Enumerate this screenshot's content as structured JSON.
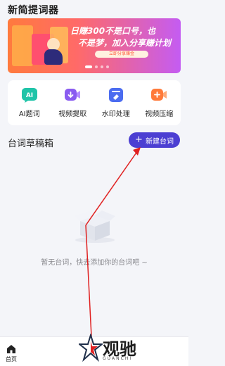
{
  "app": {
    "title": "新简提词器"
  },
  "banner": {
    "line1": "日赚300不是口号，也",
    "line2": "不是梦，加入分享赚计划",
    "cta": "立即分享赚金",
    "slide_count": 4,
    "active_slide": 0
  },
  "tools": [
    {
      "label": "AI题词",
      "icon": "ai-icon",
      "color": "#1fc4a8"
    },
    {
      "label": "视频提取",
      "icon": "video-extract-icon",
      "color": "#8a5cf0"
    },
    {
      "label": "水印处理",
      "icon": "watermark-icon",
      "color": "#4b6cf0"
    },
    {
      "label": "视频压缩",
      "icon": "video-compress-icon",
      "color": "#ff7a3a"
    }
  ],
  "drafts": {
    "title": "台词草稿箱",
    "new_button": "新建台词",
    "empty_text": "暂无台词，快去添加你的台词吧 ~"
  },
  "bottom_nav": {
    "home_label": "首页"
  },
  "watermark": {
    "text": "观驰",
    "sub": "GUANCHI"
  },
  "colors": {
    "accent": "#4c3fd2",
    "annotation": "#e02020"
  }
}
